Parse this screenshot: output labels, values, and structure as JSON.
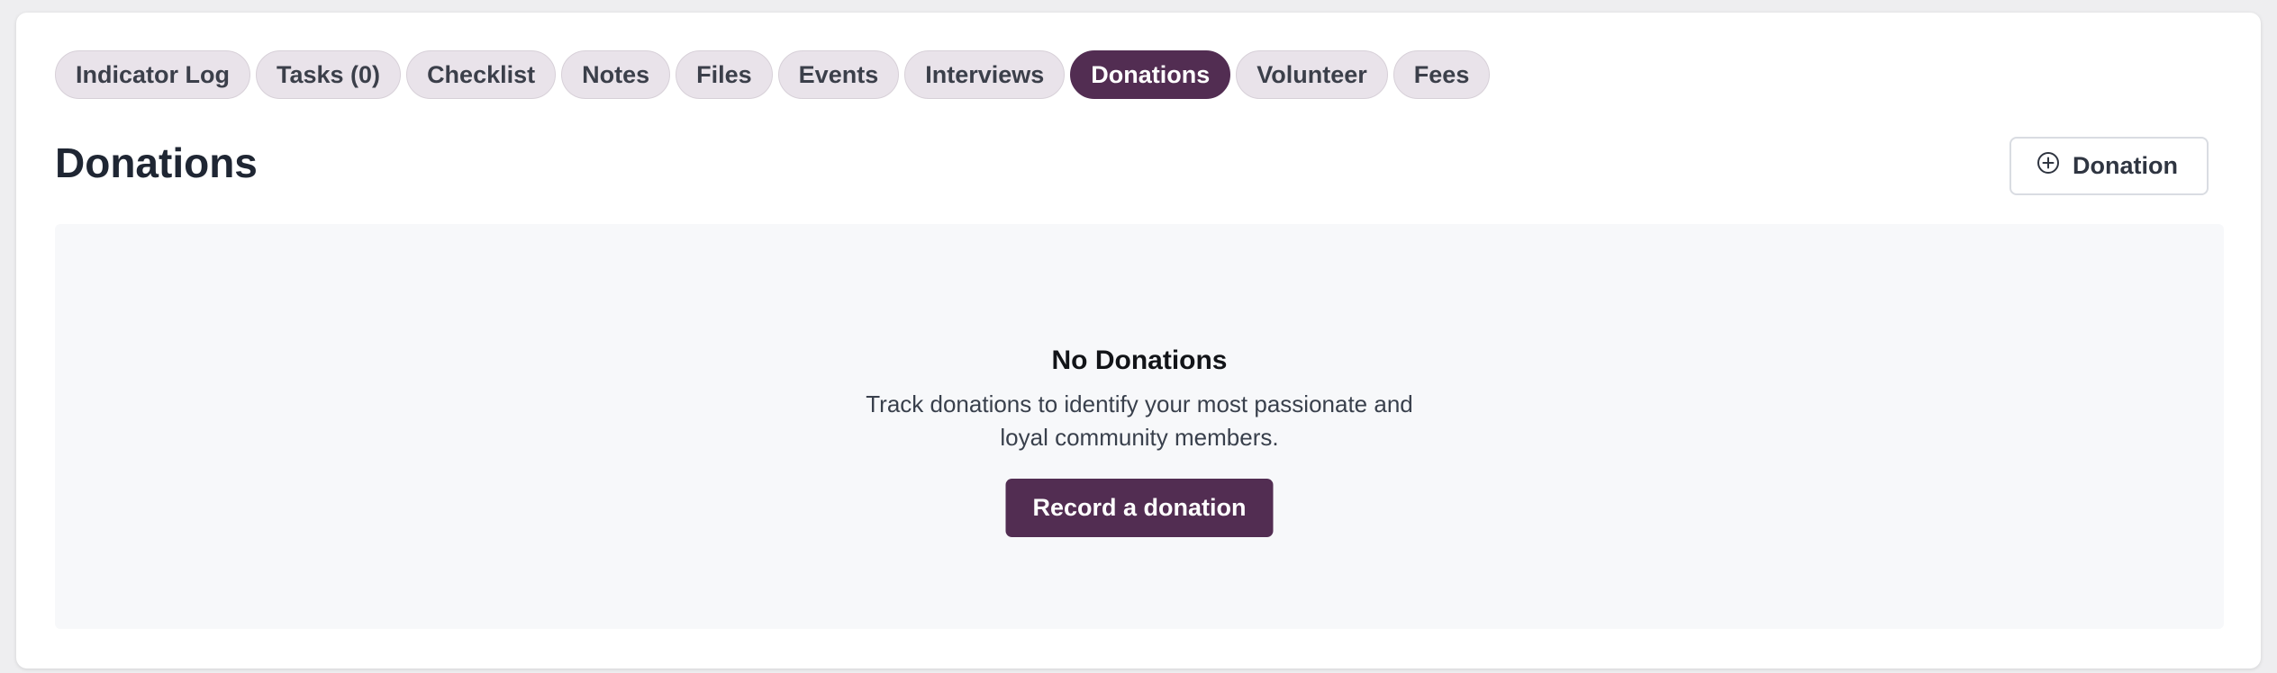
{
  "tabs": [
    {
      "label": "Indicator Log",
      "active": false
    },
    {
      "label": "Tasks (0)",
      "active": false
    },
    {
      "label": "Checklist",
      "active": false
    },
    {
      "label": "Notes",
      "active": false
    },
    {
      "label": "Files",
      "active": false
    },
    {
      "label": "Events",
      "active": false
    },
    {
      "label": "Interviews",
      "active": false
    },
    {
      "label": "Donations",
      "active": true
    },
    {
      "label": "Volunteer",
      "active": false
    },
    {
      "label": "Fees",
      "active": false
    }
  ],
  "header": {
    "title": "Donations",
    "add_button_label": "Donation",
    "add_button_icon": "plus-circle-icon"
  },
  "empty_state": {
    "title": "No Donations",
    "description": "Track donations to identify your most passionate and loyal community members.",
    "action_label": "Record a donation"
  },
  "colors": {
    "accent": "#522d52",
    "tab_background": "#e9e3ea",
    "panel_background": "#f7f8fa"
  }
}
